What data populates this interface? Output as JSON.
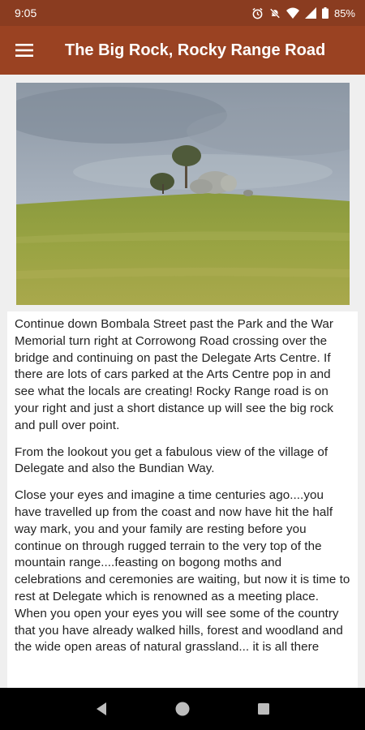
{
  "status_bar": {
    "time": "9:05",
    "battery": "85%",
    "icons": [
      "alarm-icon",
      "mute-icon",
      "wifi-icon",
      "signal-icon",
      "battery-icon"
    ]
  },
  "app_bar": {
    "title": "The Big Rock, Rocky Range Road",
    "menu_icon": "hamburger-menu-icon",
    "color": "#9a4222"
  },
  "article": {
    "paragraphs": [
      "Continue down Bombala Street past the Park and the War Memorial turn right at Corrowong Road crossing over the bridge and continuing on past the Delegate Arts Centre. If there are lots of cars parked at the Arts Centre pop in and see what the locals are creating! Rocky Range road is on your right and just a short distance up will see the big rock and pull over point.",
      "From the lookout you get a fabulous view of the village of Delegate and also the Bundian Way.",
      "Close your eyes and imagine a time centuries ago....you have travelled up from the coast and now have hit the half way mark, you and your family are resting before you continue on through rugged terrain to the very top of the mountain range....feasting on bogong moths and celebrations and ceremonies are waiting, but now it is time to rest at Delegate which is renowned as a meeting place. When you open your eyes you will see some of the country that you have already walked hills, forest and woodland and the wide open areas of natural grassland... it is all there"
    ]
  },
  "nav_bar": {
    "icons": [
      "back-icon",
      "home-icon",
      "recents-icon"
    ]
  }
}
